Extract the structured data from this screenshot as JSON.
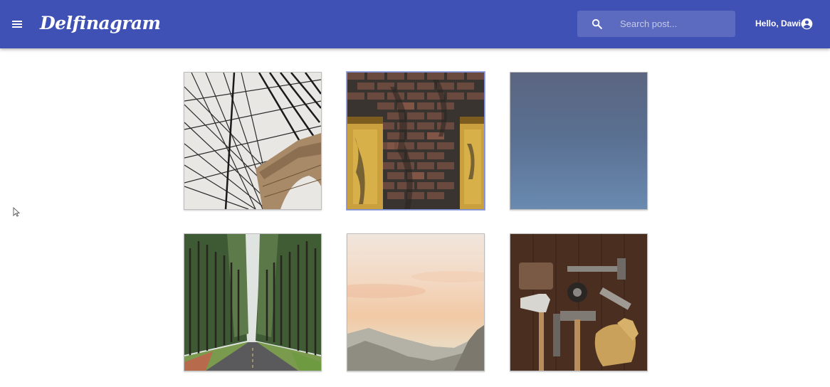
{
  "app": {
    "title": "Delfinagram"
  },
  "header": {
    "menu_icon": "hamburger-menu-icon",
    "search": {
      "placeholder": "Search post...",
      "value": "",
      "icon": "search-icon"
    },
    "user": {
      "greeting": "Hello, Dawid",
      "icon": "account-circle-icon"
    }
  },
  "posts": [
    {
      "subject": "suspension bridge cables"
    },
    {
      "subject": "brick wall with wooden doors",
      "selected": true
    },
    {
      "subject": "blue sky"
    },
    {
      "subject": "forest road"
    },
    {
      "subject": "mountain sunset sky"
    },
    {
      "subject": "tools on wooden table"
    }
  ],
  "colors": {
    "primary": "#3f51b5",
    "search_bg": "#5c6bc0"
  }
}
